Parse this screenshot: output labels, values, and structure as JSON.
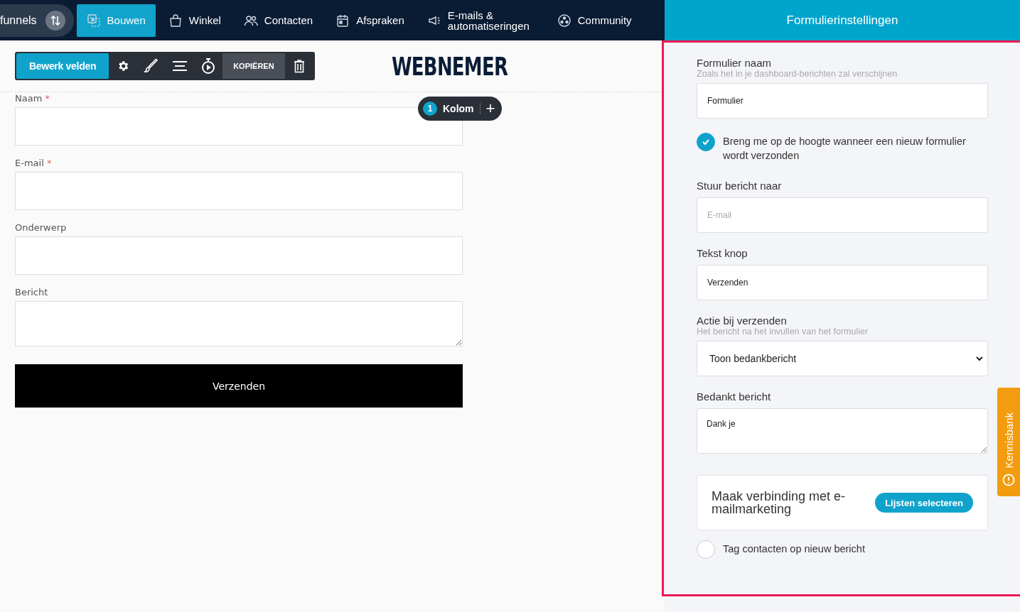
{
  "nav": {
    "items": [
      {
        "label": "funnels",
        "kind": "switcher"
      },
      {
        "label": "Bouwen",
        "kind": "build",
        "selected": true
      },
      {
        "label": "Winkel",
        "kind": "shop",
        "selected": false
      },
      {
        "label": "Contacten",
        "kind": "contacts",
        "selected": false
      },
      {
        "label": "Afspraken",
        "kind": "calendar",
        "selected": false
      },
      {
        "label": "E-mails & automatiseringen",
        "kind": "megaphone",
        "selected": false
      },
      {
        "label": "Community",
        "kind": "community",
        "selected": false
      }
    ]
  },
  "toolbar": {
    "primary": "Bewerk velden",
    "copy": "KOPIËREN"
  },
  "logo": "WEBNEMER",
  "column_pill": {
    "count": "1",
    "label": "Kolom",
    "add": "+"
  },
  "form": {
    "fields": [
      {
        "label": "Naam",
        "marker": "*",
        "kind": "input"
      },
      {
        "label": "E-mail",
        "marker": "*",
        "kind": "input"
      },
      {
        "label": "Onderwerp",
        "kind": "input"
      },
      {
        "label": "Bericht",
        "kind": "textarea"
      }
    ],
    "submit": "Verzenden"
  },
  "settings": {
    "title": "Formulierinstellingen",
    "items": [
      {
        "kind": "input",
        "label": "Formulier naam",
        "hint": "Zoals het in je dashboard-berichten zal verschijnen",
        "value": "Formulier"
      },
      {
        "kind": "toggle",
        "label": "Breng me op de hoogte wanneer een nieuw formulier wordt verzonden",
        "checked": true
      },
      {
        "kind": "input",
        "label": "Stuur bericht naar",
        "placeholder": "E-mail"
      },
      {
        "kind": "input",
        "label": "Tekst knop",
        "value": "Verzenden"
      },
      {
        "kind": "select",
        "label": "Actie bij verzenden",
        "hint": "Het bericht na het invullen van het formulier",
        "value": "Toon bedankbericht"
      },
      {
        "kind": "textarea",
        "label": "Bedankt bericht",
        "value": "Dank je"
      },
      {
        "kind": "connect",
        "label": "Maak verbinding met e-mailmarketing",
        "button": "Lijsten selecteren"
      },
      {
        "kind": "toggle",
        "label": "Tag contacten op nieuw bericht",
        "checked": false
      }
    ]
  },
  "help_tab": {
    "label": "Kennisbank"
  }
}
